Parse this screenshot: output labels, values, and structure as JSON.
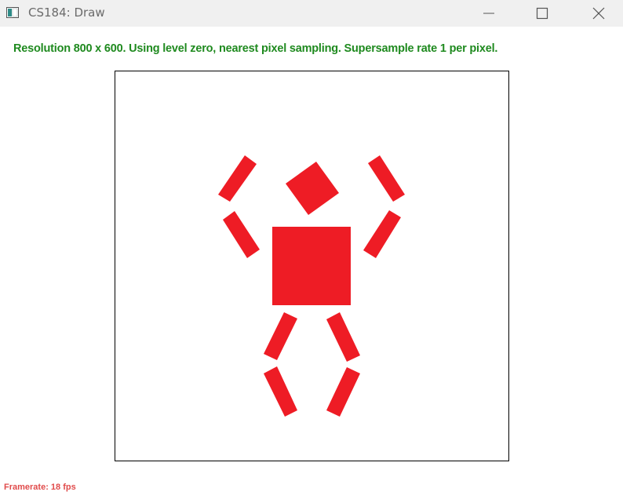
{
  "window": {
    "title": "CS184: Draw",
    "controls": {
      "minimize_icon": "minimize-icon",
      "maximize_icon": "maximize-icon",
      "close_icon": "close-icon"
    }
  },
  "status": {
    "text": "Resolution 800 x 600. Using level zero, nearest pixel sampling. Supersample rate 1 per pixel.",
    "color": "#1f8a1f"
  },
  "figure": {
    "fill_color": "#ee1c25",
    "shapes": [
      "head",
      "torso",
      "left-upper-arm",
      "left-lower-arm",
      "right-upper-arm",
      "right-lower-arm",
      "left-upper-leg",
      "left-lower-leg",
      "right-upper-leg",
      "right-lower-leg"
    ]
  },
  "footer": {
    "framerate": "Framerate: 18 fps",
    "color": "#e04b4b"
  }
}
